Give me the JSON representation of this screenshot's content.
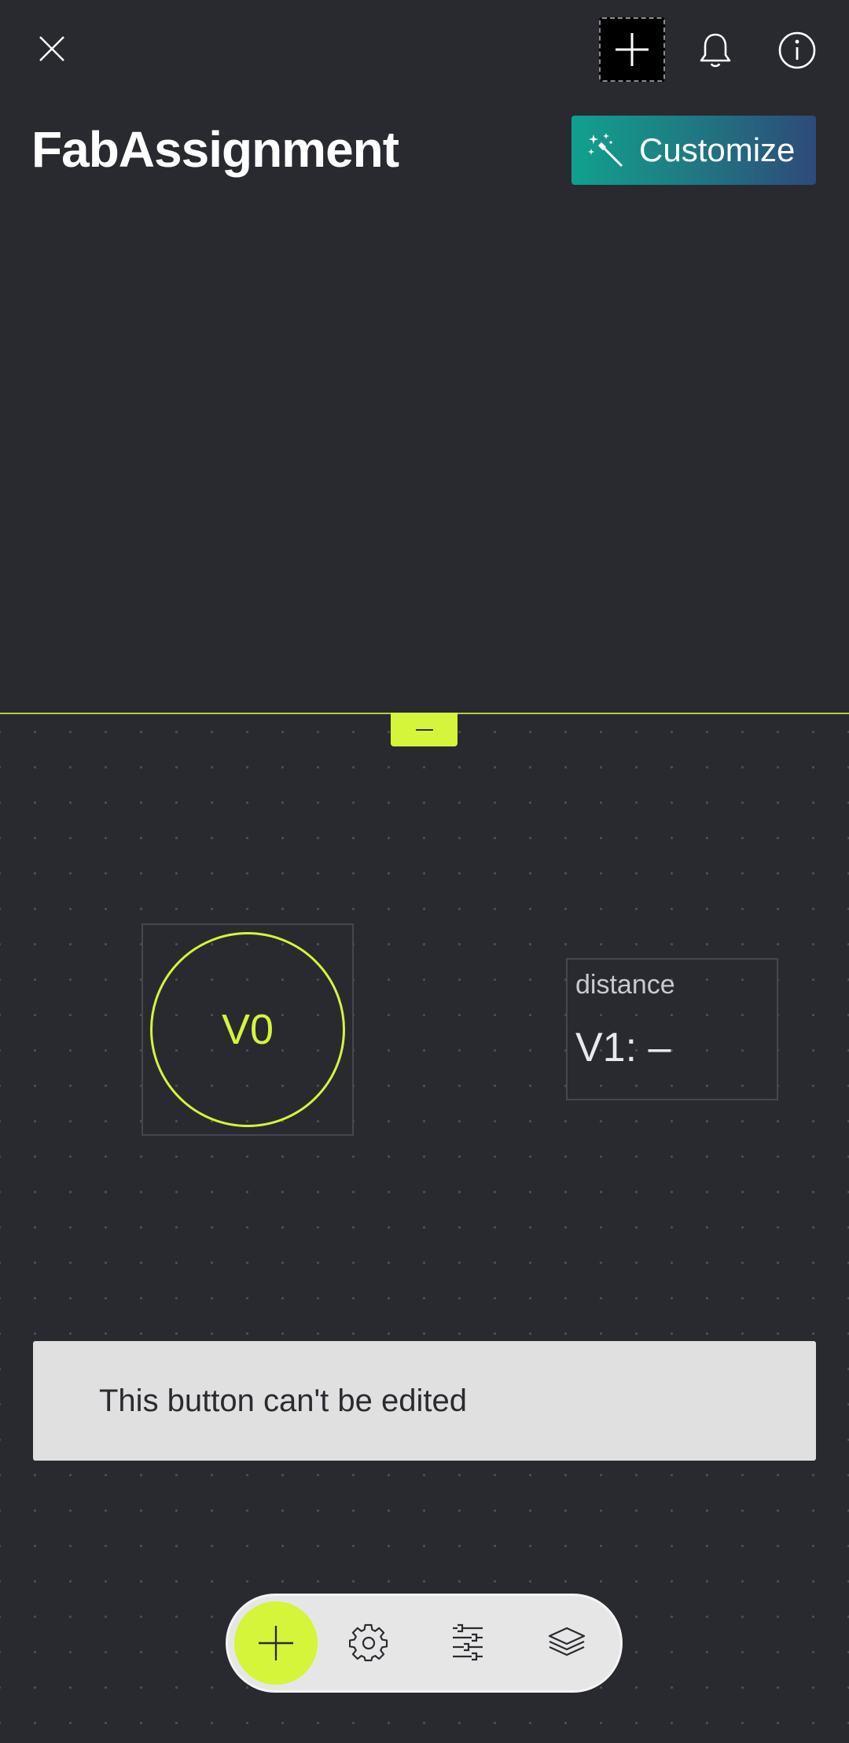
{
  "header": {
    "title": "FabAssignment",
    "customize_label": "Customize",
    "icons": {
      "close": "close-icon",
      "add": "plus-icon",
      "notifications": "bell-icon",
      "info": "info-icon",
      "customize": "magic-wand-icon"
    }
  },
  "panel": {
    "collapse_icon": "minus-icon"
  },
  "canvas": {
    "widgets": [
      {
        "type": "button",
        "label": "V0"
      },
      {
        "type": "value-display",
        "title": "distance",
        "value": "V1: –"
      }
    ]
  },
  "toast": {
    "message": "This button can't be edited"
  },
  "toolbar": {
    "items": [
      "plus-icon",
      "gear-icon",
      "sliders-icon",
      "layers-icon"
    ]
  },
  "colors": {
    "background": "#282a30",
    "accent": "#d4f53a",
    "toast_bg": "#e0e0e0",
    "toolbar_bg": "#e6e6e6"
  }
}
